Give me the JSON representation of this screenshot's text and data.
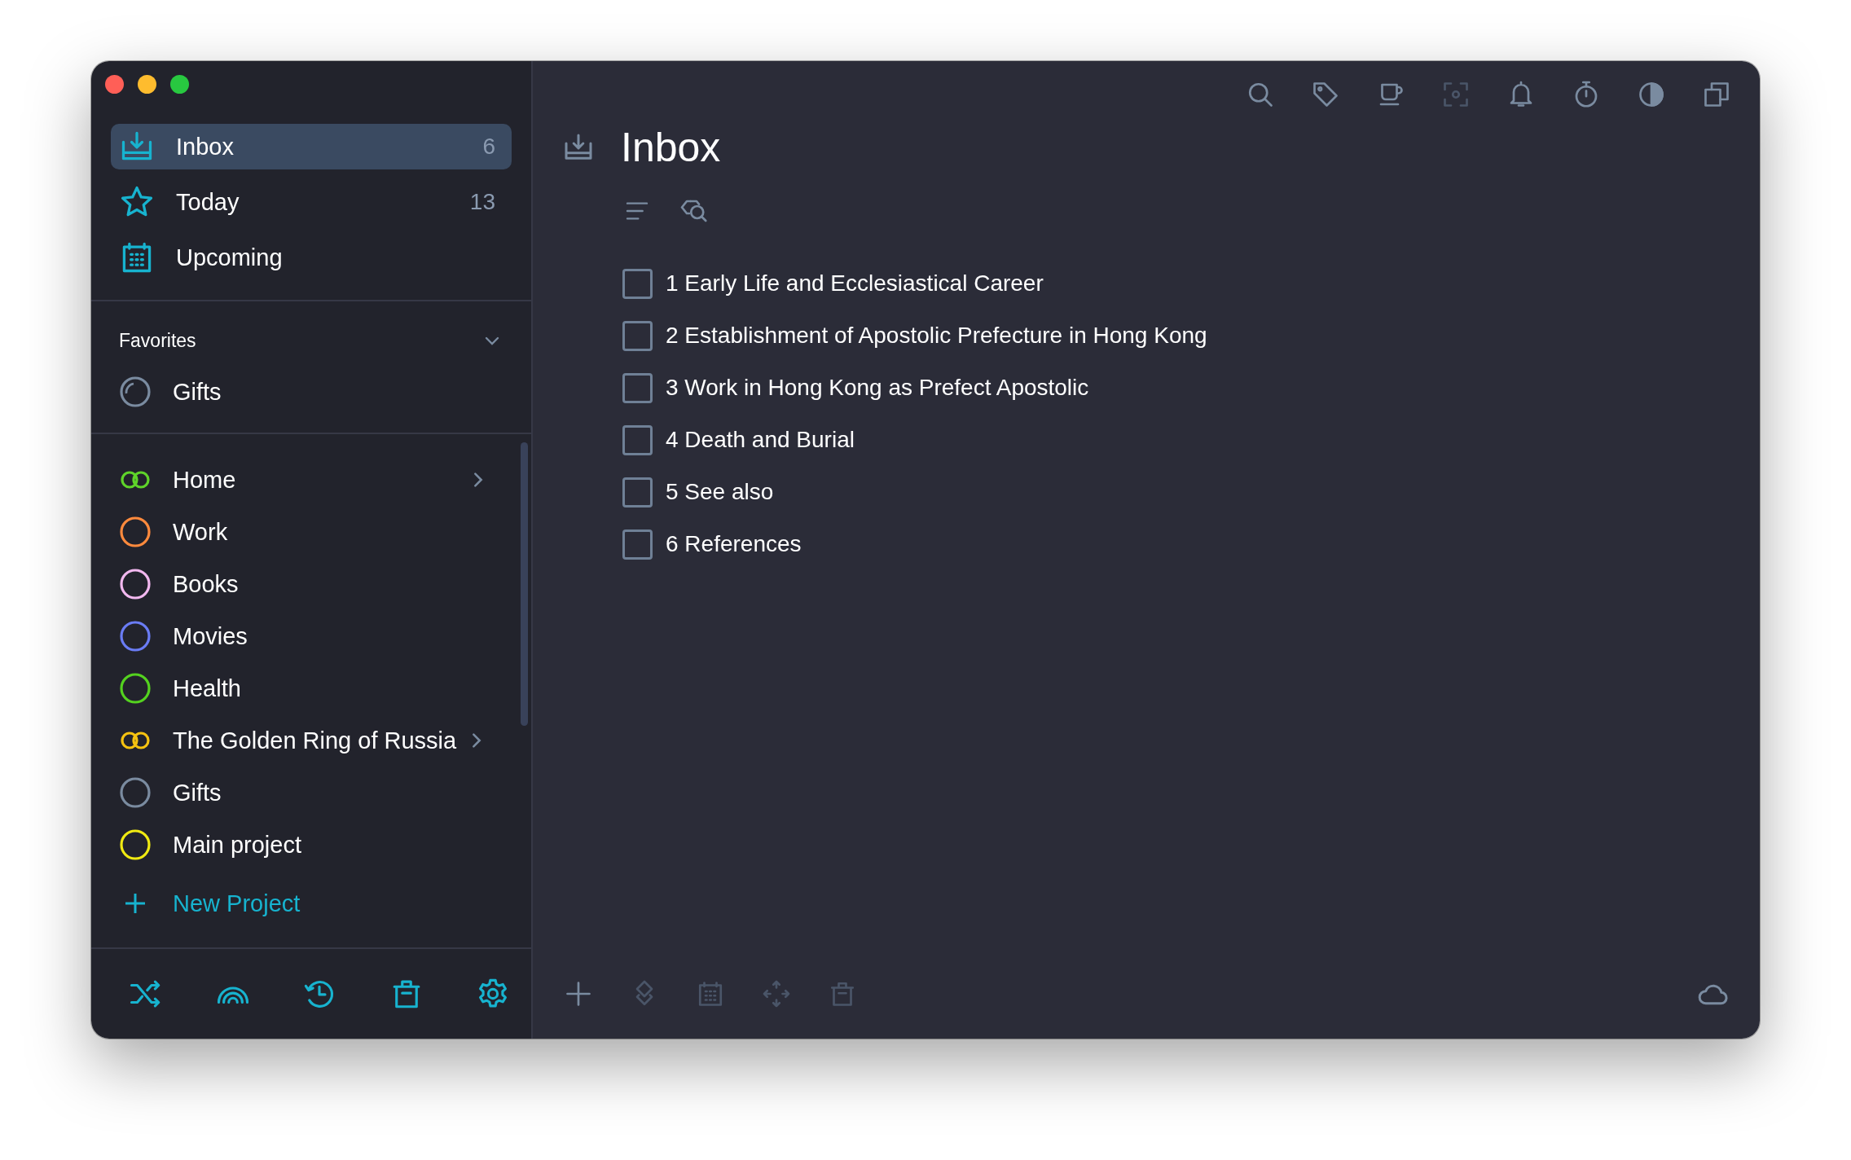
{
  "sidebar": {
    "nav": [
      {
        "label": "Inbox",
        "count": "6",
        "selected": true
      },
      {
        "label": "Today",
        "count": "13",
        "selected": false
      },
      {
        "label": "Upcoming",
        "selected": false
      }
    ],
    "favorites": {
      "title": "Favorites",
      "expanded": true,
      "items": [
        {
          "kind": "progress",
          "label": "Gifts",
          "color": "#7a8ba0"
        }
      ]
    },
    "projects": [
      {
        "kind": "rings",
        "label": "Home",
        "color": "#5fd32a",
        "expandable": true
      },
      {
        "kind": "circle",
        "label": "Work",
        "color": "#ff8a3d",
        "expandable": false
      },
      {
        "kind": "circle",
        "label": "Books",
        "color": "#f2b8ef",
        "expandable": false
      },
      {
        "kind": "circle",
        "label": "Movies",
        "color": "#6a7cf5",
        "expandable": false
      },
      {
        "kind": "circle",
        "label": "Health",
        "color": "#54d21f",
        "expandable": false
      },
      {
        "kind": "rings",
        "label": "The Golden Ring of Russia",
        "color": "#f5c211",
        "expandable": true
      },
      {
        "kind": "circle",
        "label": "Gifts",
        "color": "#7a8ba0",
        "expandable": false
      },
      {
        "kind": "circle",
        "label": "Main project",
        "color": "#f0ea12",
        "expandable": false
      }
    ],
    "new_project": "New Project"
  },
  "toolbar": [
    {
      "disabled": false
    },
    {
      "disabled": false
    },
    {
      "disabled": false
    },
    {
      "disabled": true
    },
    {
      "disabled": false
    },
    {
      "disabled": false
    },
    {
      "disabled": false
    },
    {
      "disabled": false
    }
  ],
  "main": {
    "title": "Inbox",
    "tasks": [
      {
        "label": "1 Early Life and Ecclesiastical Career",
        "checked": false
      },
      {
        "label": "2 Establishment of Apostolic Prefecture in Hong Kong",
        "checked": false
      },
      {
        "label": "3 Work in Hong Kong as Prefect Apostolic",
        "checked": false
      },
      {
        "label": "4 Death and Burial",
        "checked": false
      },
      {
        "label": "5 See also",
        "checked": false
      },
      {
        "label": "6 References",
        "checked": false
      }
    ]
  },
  "bottom_bar": [
    {
      "disabled": false
    },
    {
      "disabled": true
    },
    {
      "disabled": true
    },
    {
      "disabled": true
    },
    {
      "disabled": true
    }
  ]
}
